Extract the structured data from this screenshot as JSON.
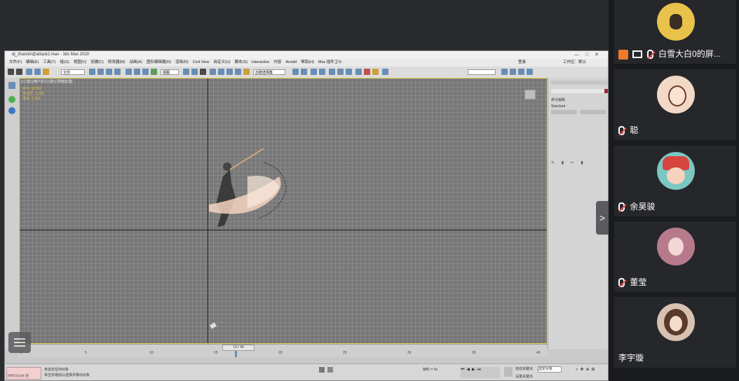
{
  "max": {
    "title": "dj_zhanshi@attack2.max - 3ds Max 2020",
    "menu": [
      "文件(F)",
      "编辑(E)",
      "工具(T)",
      "组(G)",
      "视图(V)",
      "创建(C)",
      "修改器(M)",
      "动画(A)",
      "图形编辑器(D)",
      "渲染(R)",
      "Civil View",
      "自定义(U)",
      "脚本(S)",
      "Interactive",
      "内容",
      "Arnold",
      "帮助(H)",
      "Max 插件卫士"
    ],
    "user_label": "登录",
    "workspace_label": "工作区：默认",
    "tool_dropdown": "全部",
    "view_dropdown": "视图",
    "selset_dropdown": "创建选择集",
    "viewport_label": "[+] [前] [用户定义] [默认明暗处理]",
    "fps": "FPS: 33.561",
    "stats": [
      "多边形: 1,234",
      "顶点: 1,156"
    ],
    "timeline_value": "13 / 40",
    "timeline_ticks": [
      "0",
      "5",
      "10",
      "15",
      "20",
      "25",
      "30",
      "35",
      "40"
    ],
    "status_line1": "未选定任何对象",
    "status_line2": "单击并拖动以选择并移动对象",
    "maxscript_label": "MAXScript 迷",
    "time_label": "帧时 = 0s",
    "autokey_label": "自动关键点",
    "setkey_label": "设置关键点",
    "selected_dropdown": "选定对象",
    "cmd_panel": [
      "命令面板",
      "Standard",
      "对象类型",
      "名称和颜色"
    ]
  },
  "participants": [
    {
      "name": "白雪大白0的屏...",
      "sharing": true,
      "avatar_color": "#e8c24a"
    },
    {
      "name": "聪",
      "sharing": false,
      "avatar_color": "#f2d9c6"
    },
    {
      "name": "余昊骏",
      "sharing": false,
      "avatar_color": "#d6453e"
    },
    {
      "name": "董莹",
      "sharing": false,
      "avatar_color": "#b77a8c"
    },
    {
      "name": "李宇璇",
      "sharing": false,
      "avatar_color": "#d7c2b2"
    }
  ],
  "collapse_glyph": ">"
}
